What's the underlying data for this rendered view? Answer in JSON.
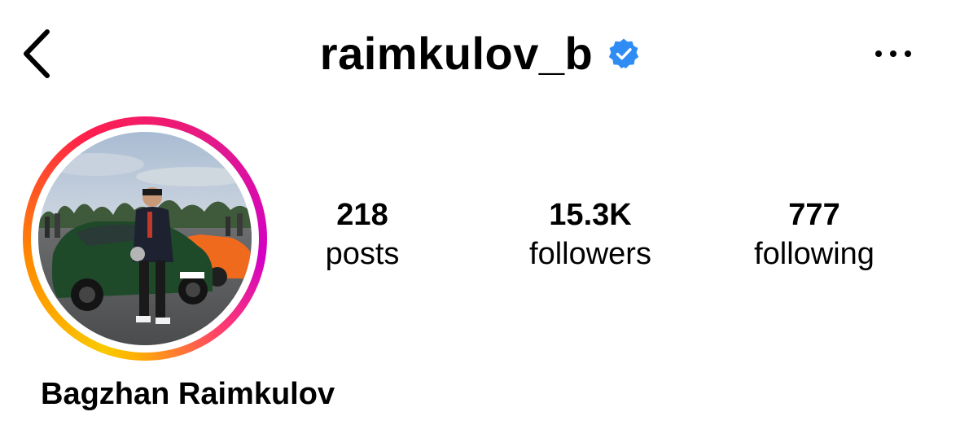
{
  "header": {
    "username": "raimkulov_b",
    "verified": true,
    "back_icon": "chevron-left-icon",
    "more_icon": "ellipsis-horizontal-icon"
  },
  "profile": {
    "avatar_story_ring": true,
    "full_name": "Bagzhan Raimkulov"
  },
  "stats": [
    {
      "value": "218",
      "label": "posts"
    },
    {
      "value": "15.3K",
      "label": "followers"
    },
    {
      "value": "777",
      "label": "following"
    }
  ],
  "colors": {
    "verified_badge": "#2f8cf5",
    "text": "#000000",
    "background": "#ffffff"
  }
}
